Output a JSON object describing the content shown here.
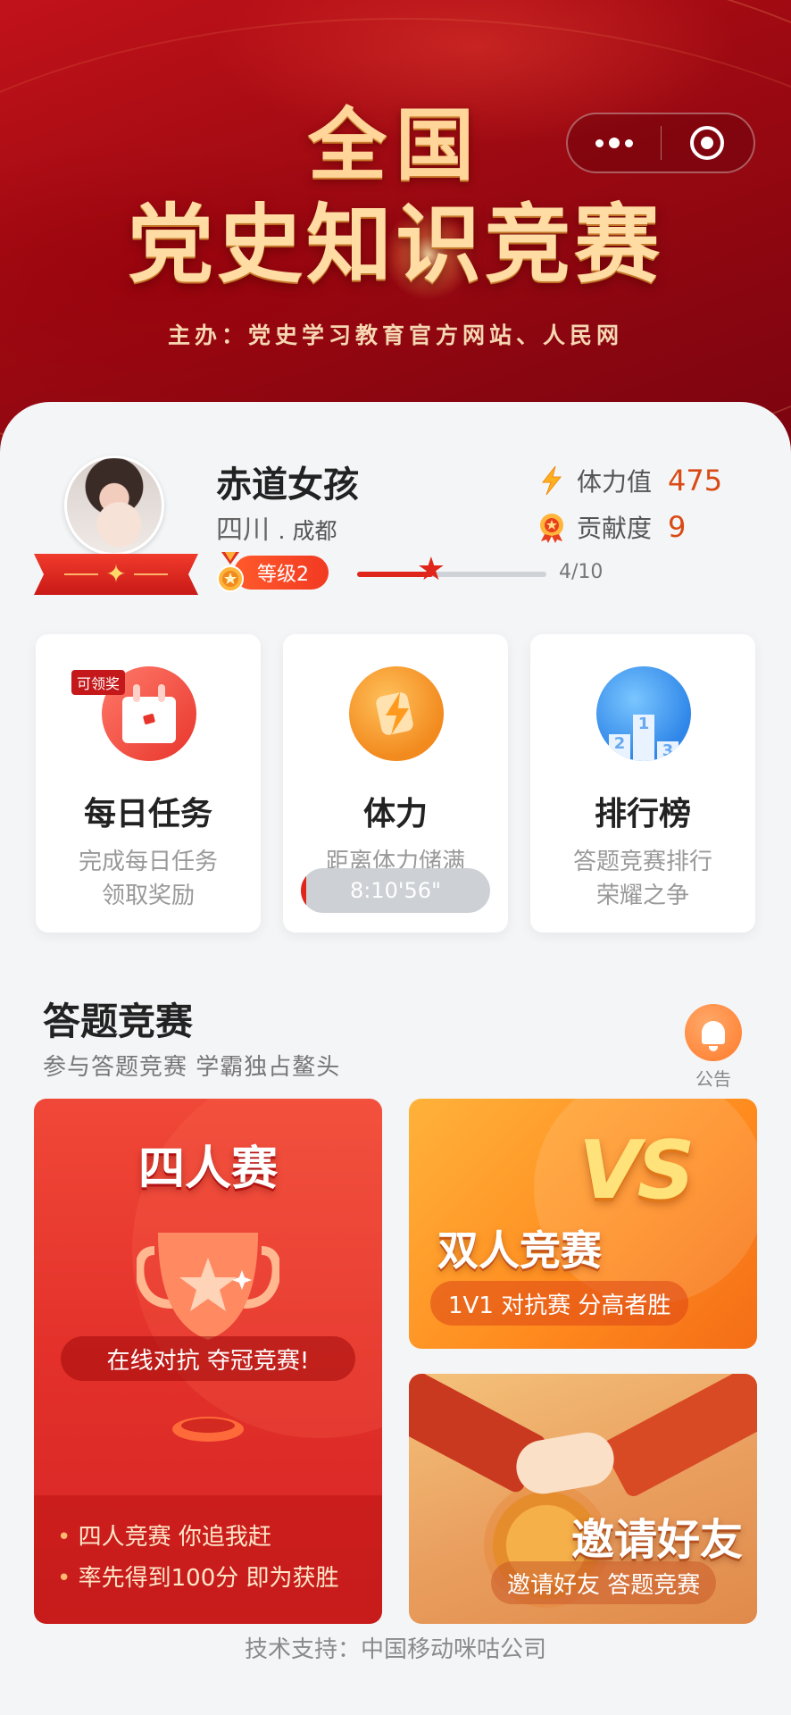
{
  "banner": {
    "title_line1": "全国",
    "title_line2": "党史知识竞赛",
    "host": "主办：党史学习教育官方网站、人民网"
  },
  "profile": {
    "nickname": "赤道女孩",
    "province": "四川",
    "city": ". 成都",
    "level_label": "等级2",
    "level_progress_text": "4/10",
    "level_progress": 0.4,
    "energy_label": "体力值",
    "energy_value": "475",
    "contribution_label": "贡献度",
    "contribution_value": "9"
  },
  "features": [
    {
      "title": "每日任务",
      "line1": "完成每日任务",
      "line2": "领取奖励",
      "tag": "可领奖",
      "icon": "calendar-icon"
    },
    {
      "title": "体力",
      "line1": "距离体力储满",
      "timer": "8:10'56\"",
      "timer_progress": 0.03,
      "icon": "lightning-icon"
    },
    {
      "title": "排行榜",
      "line1": "答题竞赛排行",
      "line2": "荣耀之争",
      "icon": "podium-icon"
    }
  ],
  "competition": {
    "title": "答题竞赛",
    "subtitle": "参与答题竞赛 学霸独占鳌头",
    "notice_label": "公告",
    "four": {
      "title": "四人赛",
      "slogan": "在线对抗 夺冠竞赛!",
      "bullets": [
        "四人竞赛 你追我赶",
        "率先得到100分 即为获胜"
      ]
    },
    "duo": {
      "badge": "VS",
      "title": "双人竞赛",
      "slogan": "1V1 对抗赛 分高者胜"
    },
    "invite": {
      "title": "邀请好友",
      "slogan": "邀请好友 答题竞赛"
    }
  },
  "footer": {
    "tech_support": "技术支持：中国移动咪咕公司"
  },
  "colors": {
    "primary_red": "#e0261a",
    "banner_red": "#a00a12",
    "gold": "#ffd59a",
    "orange": "#ff8a1e"
  }
}
